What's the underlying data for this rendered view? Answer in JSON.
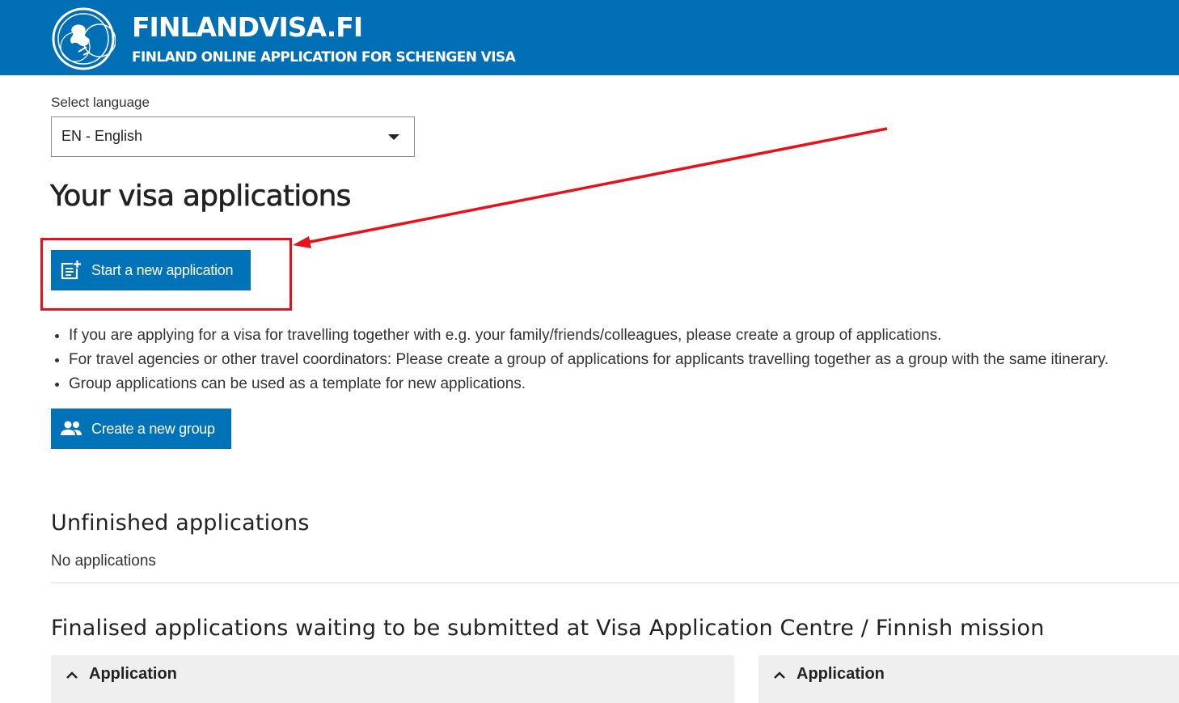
{
  "header": {
    "site_title": "FINLANDVISA.FI",
    "subtitle": "FINLAND ONLINE APPLICATION FOR SCHENGEN VISA",
    "logo_icon": "finland-lion-globe-logo"
  },
  "language": {
    "label": "Select language",
    "selected": "EN - English"
  },
  "main": {
    "title": "Your visa applications",
    "start_button": {
      "label": "Start a new application",
      "icon": "add-document-icon"
    },
    "info_items": [
      "If you are applying for a visa for travelling together with e.g. your family/friends/colleagues, please create a group of applications.",
      "For travel agencies or other travel coordinators: Please create a group of applications for applicants travelling together as a group with the same itinerary.",
      "Group applications can be used as a template for new applications."
    ],
    "group_button": {
      "label": "Create a new group",
      "icon": "group-icon"
    }
  },
  "unfinished": {
    "title": "Unfinished applications",
    "empty_text": "No applications"
  },
  "finalised": {
    "title": "Finalised applications waiting to be submitted at Visa Application Centre / Finnish mission",
    "cards": [
      {
        "title": "Application"
      },
      {
        "title": "Application"
      }
    ]
  },
  "colors": {
    "brand_blue": "#006fb6",
    "button_blue": "#0072b8",
    "annotation_red": "#e8101a"
  }
}
